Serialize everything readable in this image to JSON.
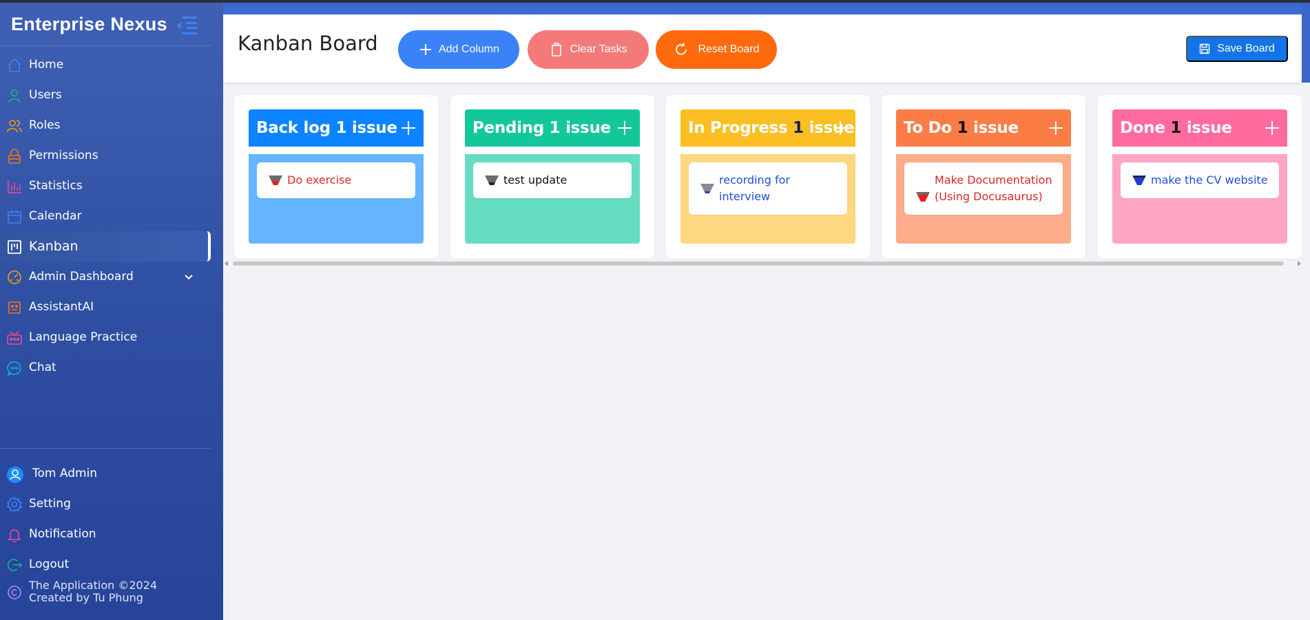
{
  "app": {
    "title": "Enterprise Nexus"
  },
  "sidebar": {
    "items": [
      {
        "label": "Home",
        "icon": "home-icon",
        "color": "#3b82f6"
      },
      {
        "label": "Users",
        "icon": "user-icon",
        "color": "#10b981"
      },
      {
        "label": "Roles",
        "icon": "roles-icon",
        "color": "#f59e0b"
      },
      {
        "label": "Permissions",
        "icon": "lock-icon",
        "color": "#f97316"
      },
      {
        "label": "Statistics",
        "icon": "bar-chart-icon",
        "color": "#ec4899"
      },
      {
        "label": "Calendar",
        "icon": "calendar-icon",
        "color": "#3b82f6"
      },
      {
        "label": "Kanban",
        "icon": "kanban-icon",
        "color": "#ffffff",
        "active": true
      },
      {
        "label": "Admin Dashboard",
        "icon": "gauge-icon",
        "color": "#f59e0b",
        "expandable": true
      },
      {
        "label": "AssistantAI",
        "icon": "robot-icon",
        "color": "#f97316"
      },
      {
        "label": "Language Practice",
        "icon": "voice-icon",
        "color": "#ec4899"
      },
      {
        "label": "Chat",
        "icon": "chat-icon",
        "color": "#06b6d4"
      }
    ],
    "bottom_items": [
      {
        "label": "Tom Admin",
        "icon": "avatar-icon"
      },
      {
        "label": "Setting",
        "icon": "gear-icon"
      },
      {
        "label": "Notification",
        "icon": "bell-icon"
      },
      {
        "label": "Logout",
        "icon": "logout-icon"
      }
    ],
    "footer": {
      "line1": "The Application ©2024",
      "line2": "Created by Tu Phung"
    }
  },
  "header": {
    "title": "Kanban Board",
    "add_column": "Add Column",
    "clear_tasks": "Clear Tasks",
    "reset_board": "Reset Board",
    "save_board": "Save Board"
  },
  "columns": [
    {
      "name": "Back log",
      "count": "1",
      "suffix": "issue",
      "head_color": "#0d84ff",
      "body_color": "#66b5ff",
      "count_style": "light",
      "tasks": [
        {
          "text": "Do exercise",
          "text_color": "#dc2626",
          "priority": "high"
        }
      ]
    },
    {
      "name": "Pending",
      "count": "1",
      "suffix": "issue",
      "head_color": "#13c79b",
      "body_color": "#66dcc3",
      "count_style": "light",
      "tasks": [
        {
          "text": "test update",
          "text_color": "#111111",
          "priority": "medium"
        }
      ]
    },
    {
      "name": "In Progress",
      "count": "1",
      "suffix": "issue",
      "head_color": "#fbbf24",
      "body_color": "#fdd781",
      "count_style": "dark",
      "tasks": [
        {
          "text": "recording for interview",
          "text_color": "#1d4ed8",
          "priority": "low"
        }
      ]
    },
    {
      "name": "To Do",
      "count": "1",
      "suffix": "issue",
      "head_color": "#fb7c45",
      "body_color": "#fcac8a",
      "count_style": "black",
      "tasks": [
        {
          "text": "Make Documentation (Using Docusaurus)",
          "text_color": "#dc2626",
          "priority": "high"
        }
      ]
    },
    {
      "name": "Done",
      "count": "1",
      "suffix": "issue",
      "head_color": "#ff6b9e",
      "body_color": "#ffa5c4",
      "count_style": "black",
      "tasks": [
        {
          "text": "make the CV website",
          "text_color": "#1d4ed8",
          "priority": "low-full"
        }
      ]
    }
  ]
}
